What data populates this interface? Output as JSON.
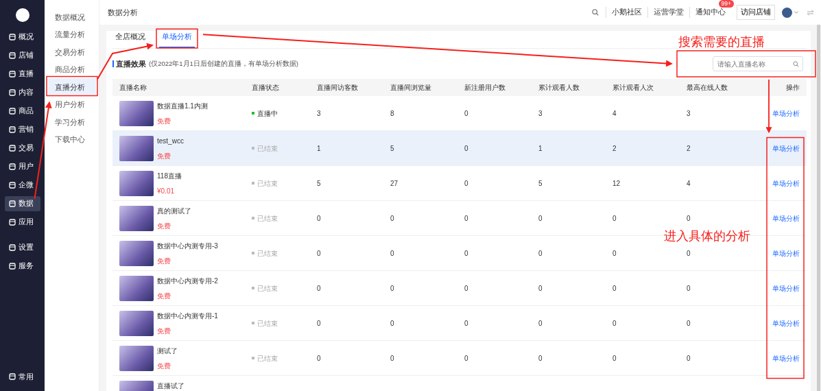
{
  "sidebar": {
    "items": [
      {
        "label": "概况",
        "selected": false
      },
      {
        "label": "店铺",
        "selected": false
      },
      {
        "label": "直播",
        "selected": false
      },
      {
        "label": "内容",
        "selected": false
      },
      {
        "label": "商品",
        "selected": false
      },
      {
        "label": "营销",
        "selected": false
      },
      {
        "label": "交易",
        "selected": false
      },
      {
        "label": "用户",
        "selected": false
      },
      {
        "label": "企微",
        "selected": false
      },
      {
        "label": "数据",
        "selected": true
      },
      {
        "label": "应用",
        "selected": false
      }
    ],
    "extra_items": [
      {
        "label": "设置",
        "selected": false
      },
      {
        "label": "服务",
        "selected": false
      }
    ],
    "footer": "常用"
  },
  "submenu": [
    {
      "label": "数据概况",
      "selected": false
    },
    {
      "label": "流量分析",
      "selected": false
    },
    {
      "label": "交易分析",
      "selected": false
    },
    {
      "label": "商品分析",
      "selected": false
    },
    {
      "label": "直播分析",
      "selected": true
    },
    {
      "label": "用户分析",
      "selected": false
    },
    {
      "label": "学习分析",
      "selected": false
    },
    {
      "label": "下载中心",
      "selected": false
    }
  ],
  "header": {
    "title": "数据分析",
    "links": [
      "小鹅社区",
      "运营学堂",
      "通知中心"
    ],
    "badge": "99+",
    "store_button": "访问店铺"
  },
  "tabs": [
    {
      "label": "全店概况",
      "selected": false
    },
    {
      "label": "单场分析",
      "selected": true
    }
  ],
  "section": {
    "title": "直播效果",
    "note": "(仅2022年1月1日后创建的直播，有单场分析数据)"
  },
  "search": {
    "placeholder": "请输入直播名称"
  },
  "table": {
    "columns": [
      "直播名称",
      "直播状态",
      "直播间访客数",
      "直播间浏览量",
      "新注册用户数",
      "累计观看人数",
      "累计观看人次",
      "最高在线人数",
      "操作"
    ],
    "rows": [
      {
        "name": "数据直播1.1内测",
        "price": "免费",
        "status": "直播中",
        "live": true,
        "highlighted": false,
        "values": [
          "3",
          "8",
          "0",
          "3",
          "4",
          "3"
        ],
        "action": "单场分析"
      },
      {
        "name": "test_wcc",
        "price": "免费",
        "status": "已结束",
        "live": false,
        "highlighted": true,
        "values": [
          "1",
          "5",
          "0",
          "1",
          "2",
          "2"
        ],
        "action": "单场分析"
      },
      {
        "name": "118直播",
        "price": "¥0.01",
        "status": "已结束",
        "live": false,
        "highlighted": false,
        "values": [
          "5",
          "27",
          "0",
          "5",
          "12",
          "4"
        ],
        "action": "单场分析"
      },
      {
        "name": "真的测试了",
        "price": "免费",
        "status": "已结束",
        "live": false,
        "highlighted": false,
        "values": [
          "0",
          "0",
          "0",
          "0",
          "0",
          "0"
        ],
        "action": "单场分析"
      },
      {
        "name": "数据中心内测专用-3",
        "price": "免费",
        "status": "已结束",
        "live": false,
        "highlighted": false,
        "values": [
          "0",
          "0",
          "0",
          "0",
          "0",
          "0"
        ],
        "action": "单场分析"
      },
      {
        "name": "数据中心内测专用-2",
        "price": "免费",
        "status": "已结束",
        "live": false,
        "highlighted": false,
        "values": [
          "0",
          "0",
          "0",
          "0",
          "0",
          "0"
        ],
        "action": "单场分析"
      },
      {
        "name": "数据中心内测专用-1",
        "price": "免费",
        "status": "已结束",
        "live": false,
        "highlighted": false,
        "values": [
          "0",
          "0",
          "0",
          "0",
          "0",
          "0"
        ],
        "action": "单场分析"
      },
      {
        "name": "测试了",
        "price": "免费",
        "status": "已结束",
        "live": false,
        "highlighted": false,
        "values": [
          "0",
          "0",
          "0",
          "0",
          "0",
          "0"
        ],
        "action": "单场分析"
      },
      {
        "name": "直播试了",
        "highlighted": false
      }
    ]
  },
  "annotations": [
    "搜索需要的直播",
    "进入具体的分析"
  ]
}
